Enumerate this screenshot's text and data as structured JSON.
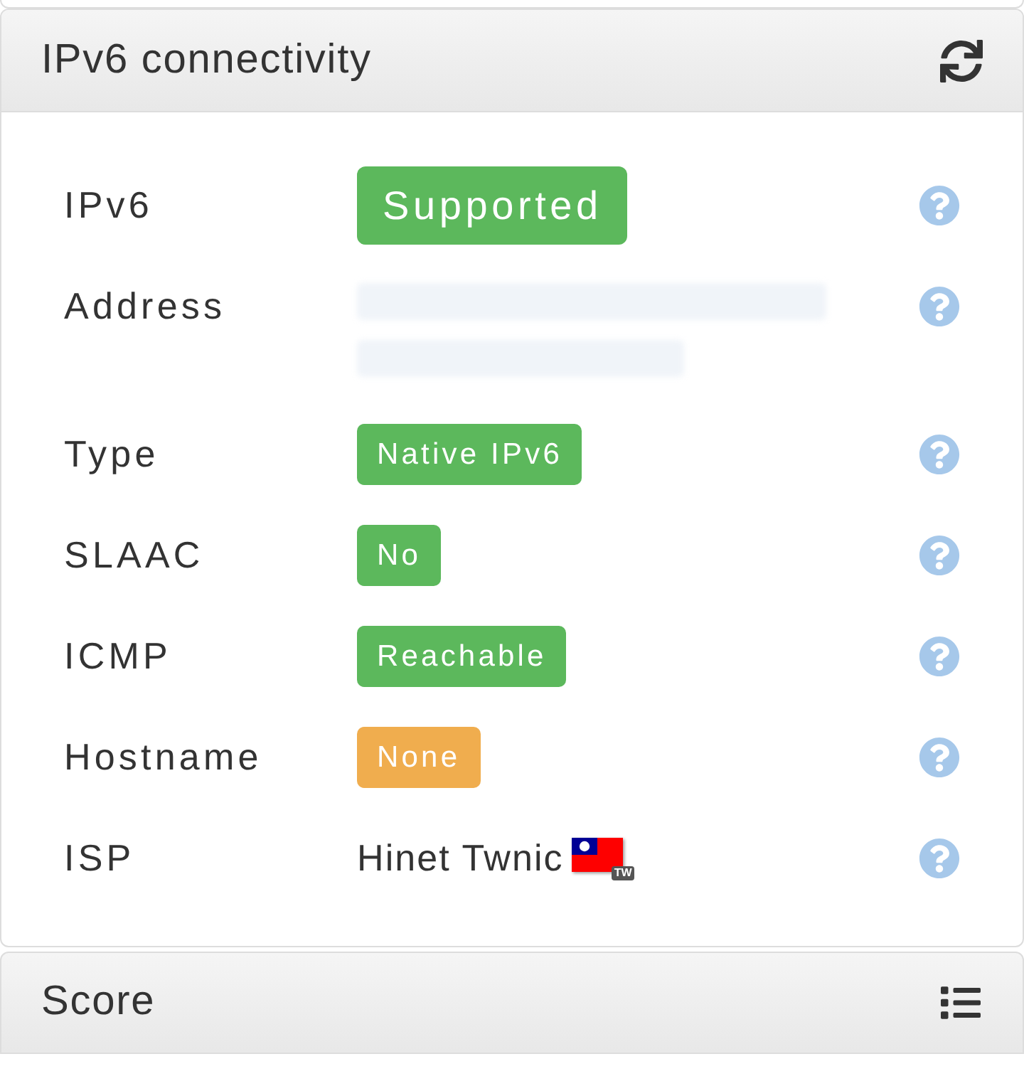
{
  "connectivity_panel": {
    "title": "IPv6 connectivity",
    "rows": [
      {
        "label": "IPv6",
        "kind": "status",
        "value": "Supported",
        "color": "#5cb85c"
      },
      {
        "label": "Address",
        "kind": "redacted"
      },
      {
        "label": "Type",
        "kind": "badge",
        "value": "Native IPv6",
        "color": "#5cb85c"
      },
      {
        "label": "SLAAC",
        "kind": "badge",
        "value": "No",
        "color": "#5cb85c"
      },
      {
        "label": "ICMP",
        "kind": "badge",
        "value": "Reachable",
        "color": "#5cb85c"
      },
      {
        "label": "Hostname",
        "kind": "badge",
        "value": "None",
        "color": "#f0ad4e"
      },
      {
        "label": "ISP",
        "kind": "isp",
        "value": "Hinet Twnic",
        "country_code": "TW"
      }
    ]
  },
  "score_panel": {
    "title": "Score"
  }
}
